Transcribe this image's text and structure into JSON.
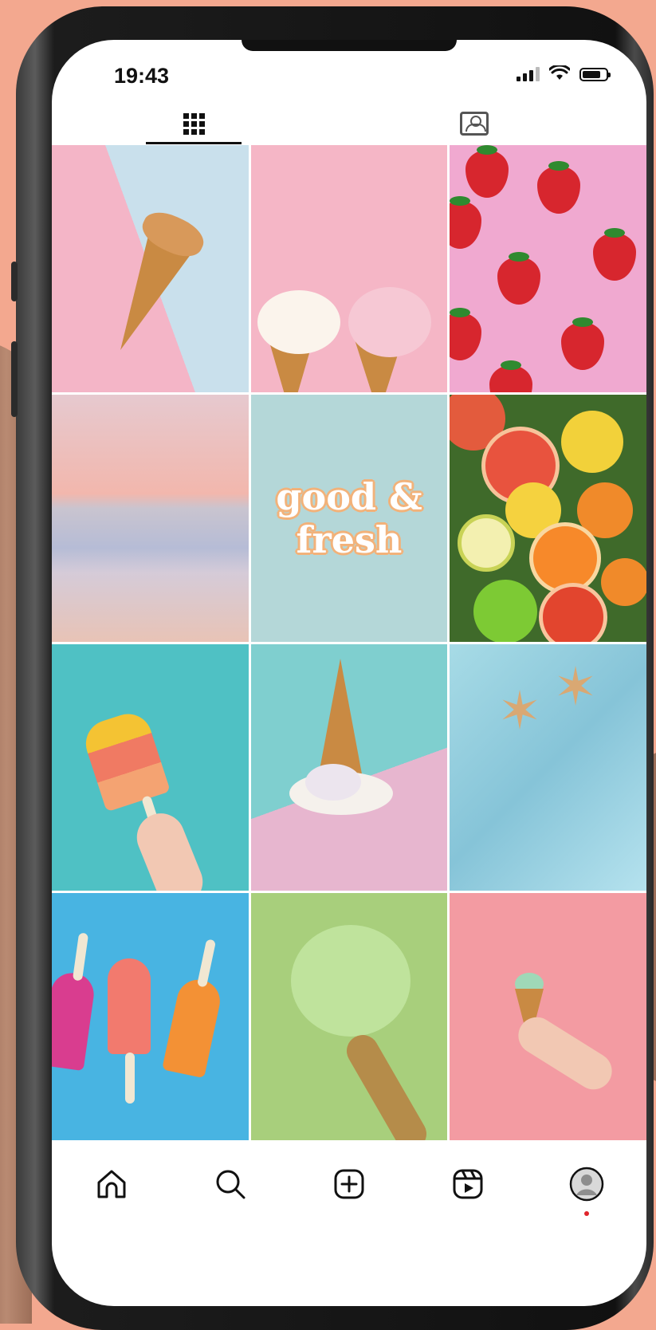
{
  "status_bar": {
    "time": "19:43"
  },
  "profile_tabs": [
    {
      "name": "posts-grid",
      "active": true
    },
    {
      "name": "tagged",
      "active": false
    }
  ],
  "grid": {
    "posts": [
      {
        "subject": "ice cream cone on pink and blue"
      },
      {
        "subject": "two ice cream cones on pink"
      },
      {
        "subject": "strawberries on pink"
      },
      {
        "subject": "pastel beach sunset"
      },
      {
        "subject": "quote tile",
        "text": "good & fresh"
      },
      {
        "subject": "mixed fruit"
      },
      {
        "subject": "popsicle in hand on teal"
      },
      {
        "subject": "melted ice cream cone"
      },
      {
        "subject": "starfish in pool water"
      },
      {
        "subject": "popsicles on blue"
      },
      {
        "subject": "pistachio ice cream scoop"
      },
      {
        "subject": "hand holding ice cream cone"
      }
    ]
  },
  "bottom_nav": [
    {
      "name": "home",
      "icon": "home-icon"
    },
    {
      "name": "search",
      "icon": "search-icon"
    },
    {
      "name": "create",
      "icon": "plus-square-icon"
    },
    {
      "name": "reels",
      "icon": "reels-icon"
    },
    {
      "name": "profile",
      "icon": "avatar-icon",
      "notification_dot": true
    }
  ],
  "colors": {
    "background": "#f3a88f",
    "notification_dot": "#e0242b"
  }
}
